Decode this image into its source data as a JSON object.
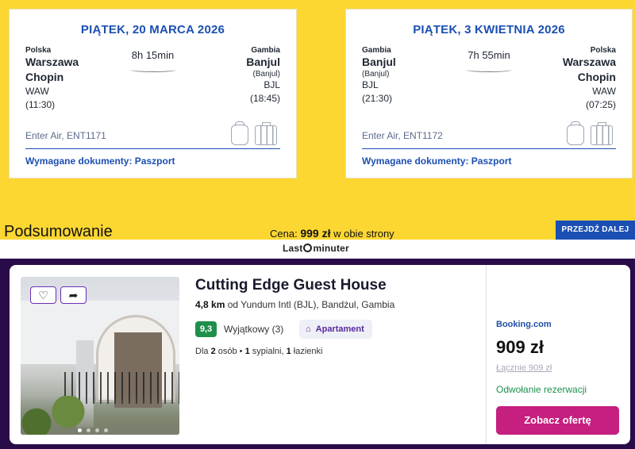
{
  "flights": [
    {
      "date": "PIĄTEK, 20 MARCA 2026",
      "from": {
        "country": "Polska",
        "city1": "Warszawa",
        "city2": "Chopin",
        "code": "WAW",
        "time": "(11:30)"
      },
      "duration": "8h 15min",
      "to": {
        "country": "Gambia",
        "city1": "Banjul",
        "sub": "(Banjul)",
        "code": "BJL",
        "time": "(18:45)"
      },
      "airline": "Enter Air, ENT1171",
      "docs": "Wymagane dokumenty: Paszport"
    },
    {
      "date": "PIĄTEK, 3 KWIETNIA 2026",
      "from": {
        "country": "Gambia",
        "city1": "Banjul",
        "sub": "(Banjul)",
        "code": "BJL",
        "time": "(21:30)"
      },
      "duration": "7h 55min",
      "to": {
        "country": "Polska",
        "city1": "Warszawa",
        "city2": "Chopin",
        "code": "WAW",
        "time": "(07:25)"
      },
      "airline": "Enter Air, ENT1172",
      "docs": "Wymagane dokumenty: Paszport"
    }
  ],
  "summary": {
    "title": "Podsumowanie",
    "price_prefix": "Cena:",
    "price_value": "999 zł",
    "price_suffix": "w obie strony",
    "next_button": "PRZEJDŹ DALEJ"
  },
  "brand": {
    "logo_left": "Last",
    "logo_right": "minuter"
  },
  "hotel": {
    "name": "Cutting Edge Guest House",
    "distance": "4,8 km",
    "distance_rest": "od Yundum Intl (BJL), Bandżul, Gambia",
    "score": "9,3",
    "score_text": "Wyjątkowy (3)",
    "type": "Apartament",
    "details_prefix": "Dla",
    "details_guests": "2",
    "details_guests_label": "osób •",
    "details_bedrooms": "1",
    "details_bedrooms_label": "sypialni,",
    "details_bathrooms": "1",
    "details_bathrooms_label": "łazienki",
    "provider": "Booking.com",
    "price": "909 zł",
    "total": "Łącznie 909 zł",
    "cancellation": "Odwołanie rezerwacji",
    "offer_button": "Zobacz ofertę"
  },
  "icons": {
    "favorite": "heart-icon",
    "share": "share-icon",
    "apartment": "building-icon",
    "backpack": "backpack-icon",
    "suitcase": "suitcase-icon"
  },
  "colors": {
    "brand_yellow": "#fdd731",
    "blue": "#1b4fb3",
    "purple_frame": "#2a0b4a",
    "score_green": "#1f8f4c",
    "offer_pink": "#c51f7f"
  }
}
